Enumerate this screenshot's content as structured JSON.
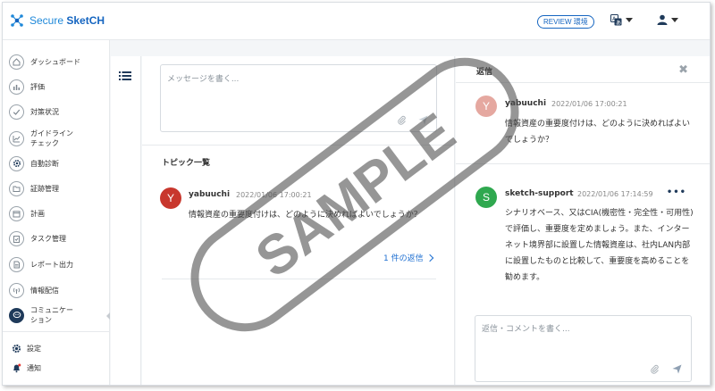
{
  "app": {
    "logo_text_a": "Secure ",
    "logo_text_b": "SketCH",
    "logo_icon": "network-nodes-icon",
    "accent": "#1e88d9",
    "nav_dark": "#1f3a5a"
  },
  "header": {
    "review_badge": "REVIEW 環境",
    "lang_icon": "translate-icon",
    "user_icon": "user-icon"
  },
  "sidebar": {
    "items": [
      {
        "label": "ダッシュボード",
        "icon": "home-icon"
      },
      {
        "label": "評価",
        "icon": "chart-icon"
      },
      {
        "label": "対策状況",
        "icon": "check-icon"
      },
      {
        "label": "ガイドライン\nチェック",
        "icon": "chart-line-icon"
      },
      {
        "label": "自動診断",
        "icon": "gear-icon"
      },
      {
        "label": "証跡管理",
        "icon": "folder-icon"
      },
      {
        "label": "計画",
        "icon": "calendar-icon"
      },
      {
        "label": "タスク管理",
        "icon": "clipboard-icon"
      },
      {
        "label": "レポート出力",
        "icon": "document-icon"
      },
      {
        "label": "情報配信",
        "icon": "broadcast-icon"
      },
      {
        "label": "コミュニケー\nション",
        "icon": "chat-icon"
      }
    ],
    "bottom": [
      {
        "label": "設定",
        "icon": "settings-icon"
      },
      {
        "label": "通知",
        "icon": "bell-icon"
      }
    ]
  },
  "main": {
    "composer_placeholder": "メッセージを書く...",
    "topic_heading": "トピック一覧",
    "topic_post": {
      "avatar": "Y",
      "author": "yabuuchi",
      "timestamp": "2022/01/06 17:00:21",
      "body": "情報資産の重要度付けは、どのように決めればよいでしょうか？"
    },
    "reply_count": "1 件の返信"
  },
  "replies": {
    "title": "返信",
    "original": {
      "avatar": "Y",
      "author": "yabuuchi",
      "timestamp": "2022/01/06 17:00:21",
      "body": "情報資産の重要度付けは、どのように決めればよいでしょうか？"
    },
    "reply": {
      "avatar": "S",
      "author": "sketch-support",
      "timestamp": "2022/01/06 17:14:59",
      "body": "シナリオベース、又はCIA(機密性・完全性・可用性)で評価し、重要度を定めましょう。また、インターネット境界部に設置した情報資産は、社内LAN内部に設置したものと比較して、重要度を高めることを勧めます。"
    },
    "reply_placeholder": "返信・コメントを書く..."
  },
  "watermark": {
    "text": "SAMPLE"
  }
}
